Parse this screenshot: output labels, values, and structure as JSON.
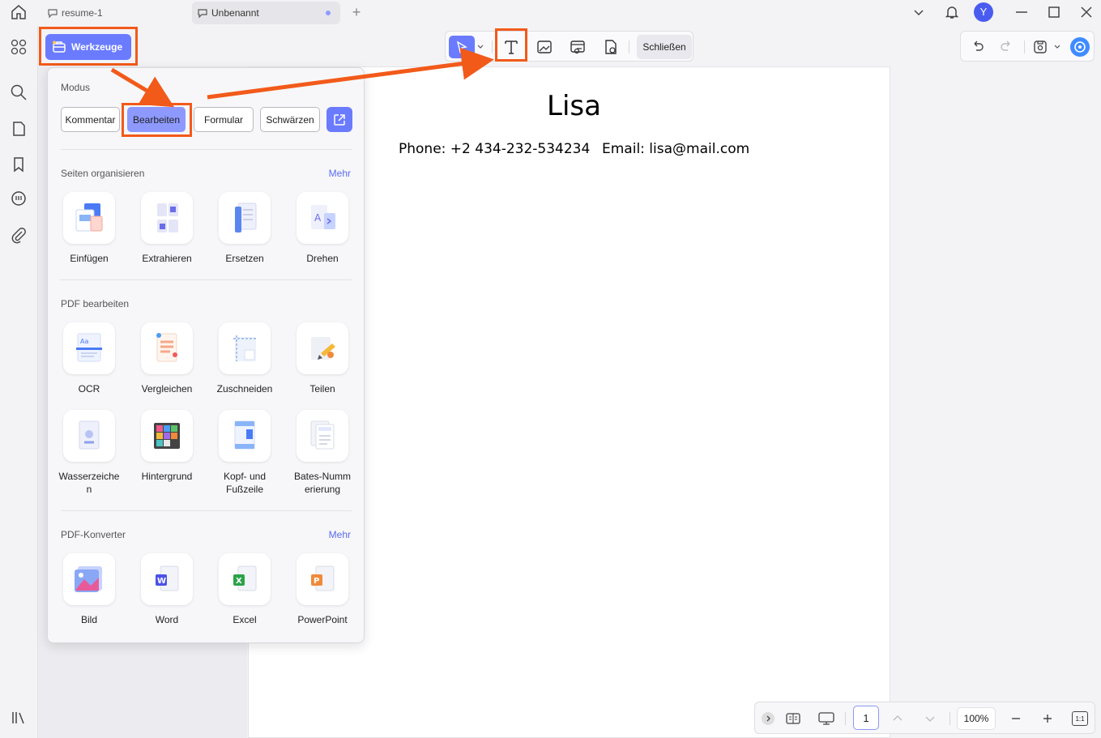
{
  "window": {
    "tabs": [
      {
        "label": "resume-1"
      },
      {
        "label": "Unbenannt"
      }
    ],
    "user_initial": "Y"
  },
  "toolbar": {
    "tools_label": "Werkzeuge",
    "close_label": "Schließen"
  },
  "document": {
    "name": "Lisa",
    "phone": "Phone: +2 434-232-534234",
    "email": "Email: lisa@mail.com"
  },
  "panel": {
    "mode_title": "Modus",
    "modes": [
      "Kommentar",
      "Bearbeiten",
      "Formular",
      "Schwärzen"
    ],
    "active_mode": "Bearbeiten",
    "sections": [
      {
        "title": "Seiten organisieren",
        "more": "Mehr",
        "items": [
          "Einfügen",
          "Extrahieren",
          "Ersetzen",
          "Drehen"
        ]
      },
      {
        "title": "PDF bearbeiten",
        "more": "",
        "items": [
          "OCR",
          "Vergleichen",
          "Zuschneiden",
          "Teilen",
          "Wasserzeiche\nn",
          "Hintergrund",
          "Kopf- und\nFußzeile",
          "Bates-Numm\nerierung"
        ]
      },
      {
        "title": "PDF-Konverter",
        "more": "Mehr",
        "items": [
          "Bild",
          "Word",
          "Excel",
          "PowerPoint"
        ]
      }
    ]
  },
  "bottombar": {
    "page": "1",
    "zoom": "100%",
    "ratio": "1:1"
  },
  "colors": {
    "accent": "#6a7bff",
    "highlight": "#f25a1a",
    "active_mode": "#8d99ff"
  }
}
